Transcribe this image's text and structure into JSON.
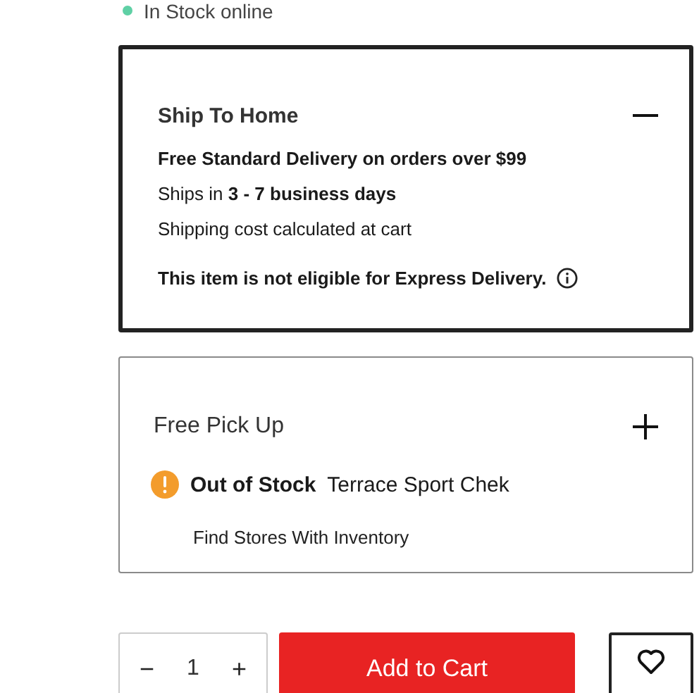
{
  "stock_status": {
    "text": "In Stock online",
    "color": "#5fd0a5"
  },
  "panels": [
    {
      "title": "Ship To Home",
      "expanded": true,
      "lines": [
        {
          "kind": "text",
          "text": "Free Standard Delivery on orders over $99",
          "bold": true
        },
        {
          "kind": "text",
          "text": "Ships in **3 - 7 business days**",
          "bold": false
        },
        {
          "kind": "text",
          "text": "Shipping cost calculated at cart",
          "bold": false
        },
        {
          "kind": "notice",
          "text": "This item is not eligible for Express Delivery.",
          "bold": true
        }
      ]
    },
    {
      "title": "Free Pick Up",
      "expanded": false,
      "lines": [
        {
          "kind": "alert",
          "status": "Out of Stock",
          "text": "Terrace Sport Chek"
        },
        {
          "kind": "link",
          "text": "Find Stores With Inventory"
        }
      ]
    }
  ],
  "quantity": {
    "decrease": "−",
    "value": "1",
    "increase": "+"
  },
  "add_to_cart": "Add to Cart"
}
